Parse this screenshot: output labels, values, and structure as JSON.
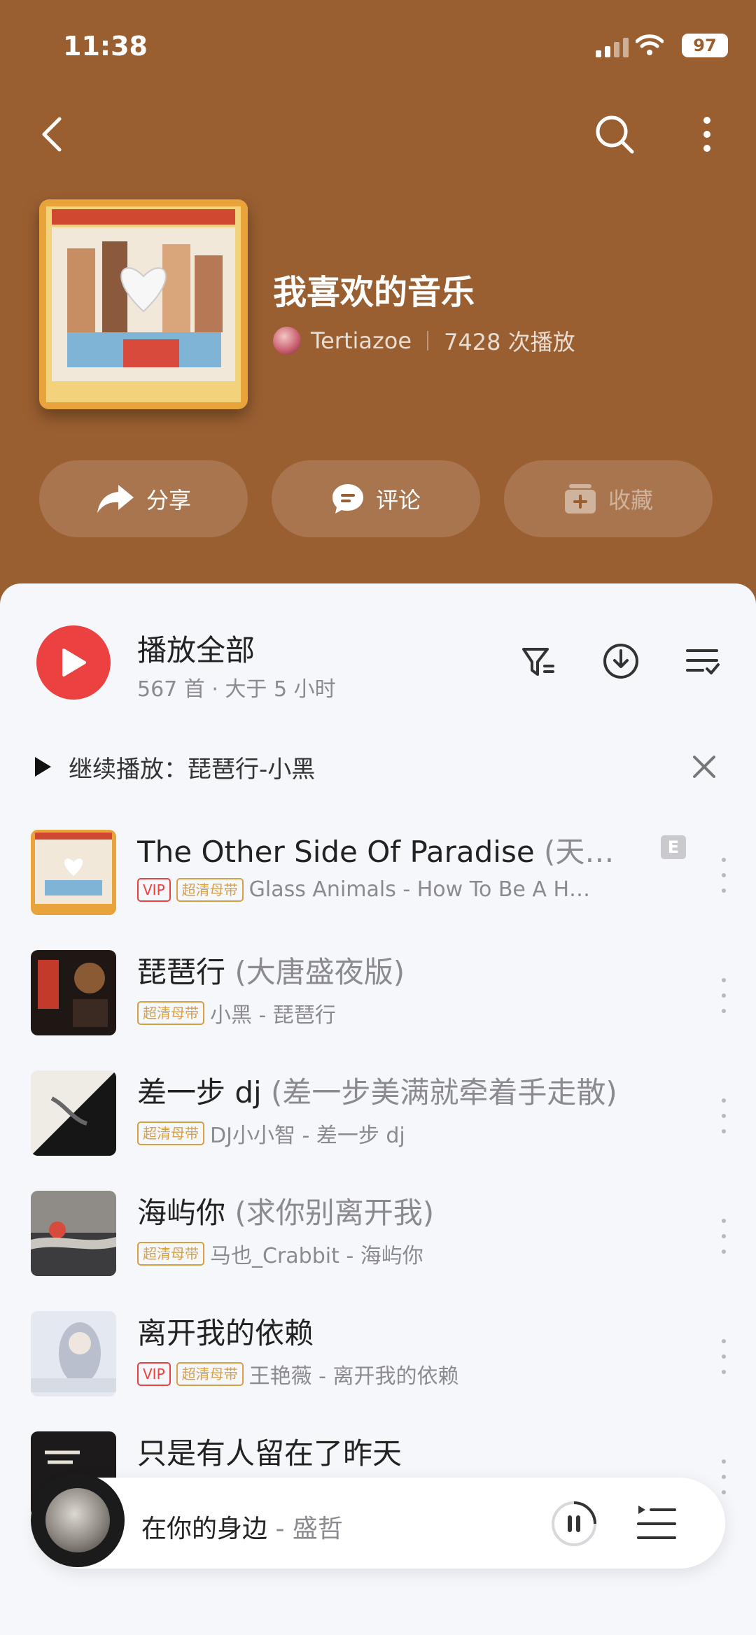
{
  "status": {
    "time": "11:38",
    "battery": "97"
  },
  "playlist": {
    "title": "我喜欢的音乐",
    "creator": "Tertiazoe",
    "plays": "7428 次播放"
  },
  "actions": {
    "share": "分享",
    "comment": "评论",
    "collect": "收藏"
  },
  "play_all": {
    "label": "播放全部",
    "sub": "567 首 · 大于 5 小时"
  },
  "continue": {
    "label": "继续播放：琵琶行-小黑"
  },
  "songs": [
    {
      "title": "The Other Side Of Paradise",
      "alias": " (天…",
      "vip": "VIP",
      "hq": "超清母带",
      "sub": "Glass Animals - How To Be A H…",
      "explicit": "E"
    },
    {
      "title": "琵琶行",
      "alias": " (大唐盛夜版)",
      "hq": "超清母带",
      "sub": "小黑 - 琵琶行"
    },
    {
      "title": "差一步 dj",
      "alias": " (差一步美满就牵着手走散)",
      "hq": "超清母带",
      "sub": "DJ小小智 - 差一步 dj"
    },
    {
      "title": "海屿你",
      "alias": " (求你别离开我)",
      "hq": "超清母带",
      "sub": "马也_Crabbit - 海屿你"
    },
    {
      "title": "离开我的依赖",
      "alias": "",
      "vip": "VIP",
      "hq": "超清母带",
      "sub": "王艳薇 - 离开我的依赖"
    },
    {
      "title": "只是有人留在了昨天",
      "alias": ""
    }
  ],
  "mini_player": {
    "song": "在你的身边",
    "artist": " - 盛哲"
  },
  "colors": {
    "header": "#9a5f31",
    "accent": "#ec4141",
    "hq_badge": "#d7a045"
  }
}
